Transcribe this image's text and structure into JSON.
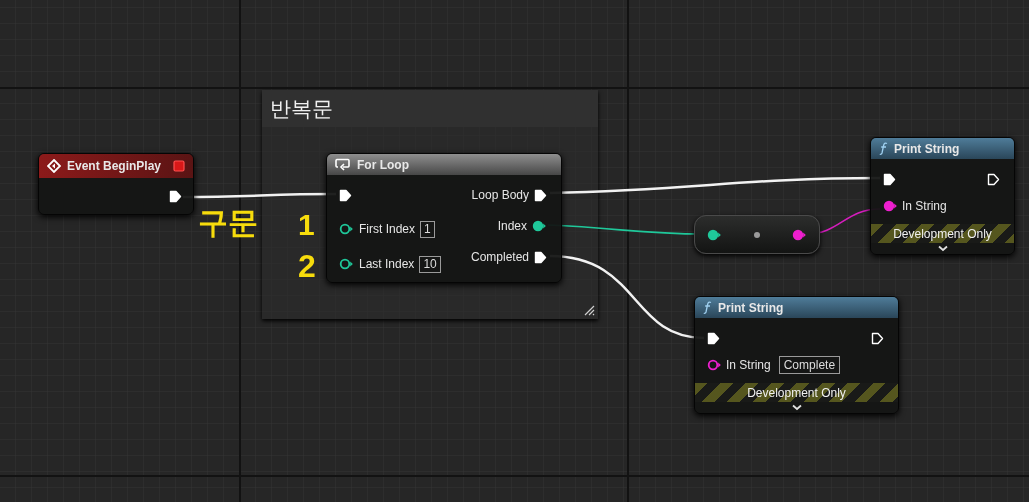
{
  "comment": {
    "title": "반복문"
  },
  "annotations": [
    "구문",
    "1",
    "2"
  ],
  "event": {
    "title": "Event BeginPlay"
  },
  "for_loop": {
    "title": "For Loop",
    "inputs": [
      {
        "label": "First Index",
        "value": "1"
      },
      {
        "label": "Last Index",
        "value": "10"
      }
    ],
    "outputs": [
      {
        "kind": "exec",
        "label": "Loop Body"
      },
      {
        "kind": "data",
        "label": "Index"
      },
      {
        "kind": "exec",
        "label": "Completed"
      }
    ]
  },
  "print_nodes": [
    {
      "title": "Print String",
      "input_label": "In String",
      "connected": true,
      "footer": "Development Only"
    },
    {
      "title": "Print String",
      "input_label": "In String",
      "connected": false,
      "value": "Complete",
      "footer": "Development Only"
    }
  ]
}
